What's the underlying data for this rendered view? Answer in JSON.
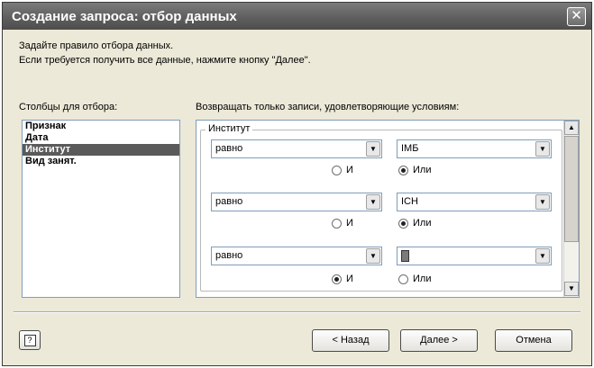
{
  "window": {
    "title": "Создание запроса: отбор данных",
    "close_glyph": "✕"
  },
  "instructions": {
    "line1": "Задайте правило отбора данных.",
    "line2": "Если требуется получить все данные, нажмите кнопку \"Далее\"."
  },
  "columns": {
    "label": "Столбцы для отбора:",
    "items": [
      "Признак",
      "Дата",
      "Институт",
      "Вид занят."
    ],
    "selected": "Институт"
  },
  "criteria": {
    "label": "Возвращать только записи, удовлетворяющие условиям:",
    "group_title": "Институт",
    "rows": [
      {
        "operator": "равно",
        "value": "IMБ",
        "and_label": "И",
        "or_label": "Или",
        "selected": "Или"
      },
      {
        "operator": "равно",
        "value": "ICH",
        "and_label": "И",
        "or_label": "Или",
        "selected": "Или"
      },
      {
        "operator": "равно",
        "value": "",
        "and_label": "И",
        "or_label": "Или",
        "selected": "И"
      }
    ]
  },
  "buttons": {
    "help_glyph": "?",
    "back": "< Назад",
    "next": "Далее >",
    "cancel": "Отмена"
  },
  "icons": {
    "dropdown": "triangle-down",
    "scroll_up": "triangle-up",
    "scroll_down": "triangle-down",
    "help": "help-icon"
  }
}
